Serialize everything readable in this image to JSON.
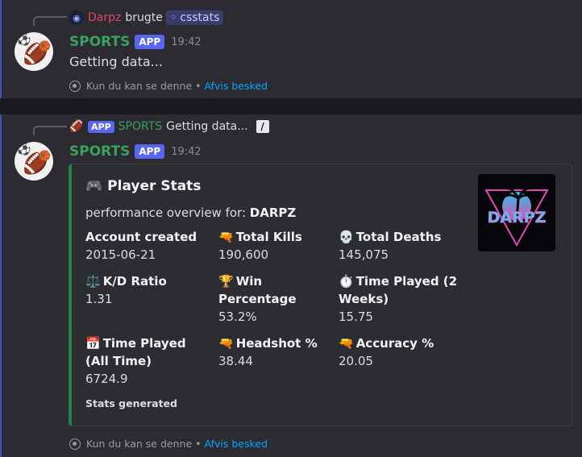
{
  "message1": {
    "reply": {
      "user": "Darpz",
      "action": "brugte",
      "command": "csstats"
    },
    "author": "SPORTS",
    "app_tag": "APP",
    "time": "19:42",
    "content": "Getting data...",
    "ephemeral_text": "Kun du kan se denne •",
    "dismiss": "Afvis besked"
  },
  "message2": {
    "reply": {
      "app_tag": "APP",
      "name": "SPORTS",
      "text": "Getting data..."
    },
    "author": "SPORTS",
    "app_tag": "APP",
    "time": "19:42",
    "embed": {
      "title": "Player Stats",
      "title_icon": "🎮",
      "desc_prefix": "performance overview for:",
      "desc_user": "DARPZ",
      "thumbnail_text": "DARPZ",
      "fields": [
        {
          "icon": "",
          "name": "Account created",
          "value": "2015-06-21"
        },
        {
          "icon": "🔫",
          "name": "Total Kills",
          "value": "190,600"
        },
        {
          "icon": "💀",
          "name": "Total Deaths",
          "value": "145,075"
        },
        {
          "icon": "⚖️",
          "name": "K/D Ratio",
          "value": "1.31"
        },
        {
          "icon": "🏆",
          "name": "Win Percentage",
          "value": "53.2%"
        },
        {
          "icon": "⏱️",
          "name": "Time Played (2 Weeks)",
          "value": "15.75"
        },
        {
          "icon": "📅",
          "name": "Time Played (All Time)",
          "value": "6724.9"
        },
        {
          "icon": "🔫",
          "name": "Headshot %",
          "value": "38.44"
        },
        {
          "icon": "🔫",
          "name": "Accuracy %",
          "value": "20.05"
        }
      ],
      "footer": "Stats generated"
    },
    "ephemeral_text": "Kun du kan se denne •",
    "dismiss": "Afvis besked"
  },
  "colors": {
    "accent": "#5865f2",
    "sports_green": "#3aa160",
    "embed_bar": "#248046",
    "link": "#00a8fc"
  }
}
